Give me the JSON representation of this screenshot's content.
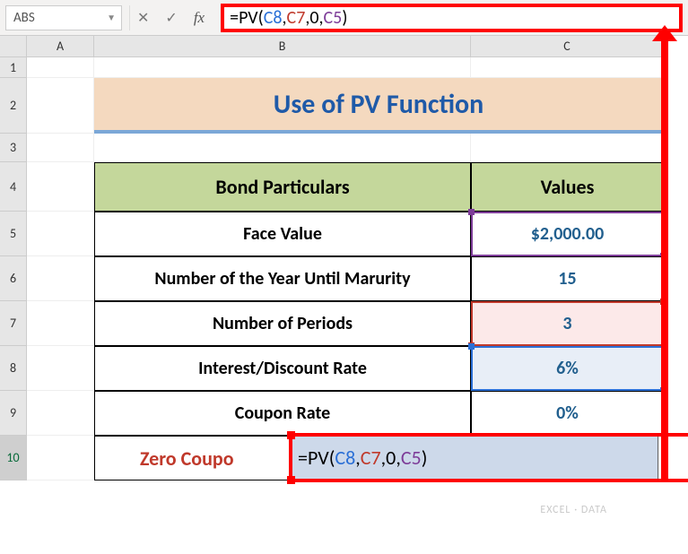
{
  "name_box": "ABS",
  "formula": {
    "prefix": "=",
    "fn": "PV",
    "open": "(",
    "arg1": "C8",
    "sep": ",",
    "arg2": "C7",
    "arg3": "0",
    "arg4": "C5",
    "close": ")"
  },
  "columns": {
    "A": "A",
    "B": "B",
    "C": "C"
  },
  "rows": {
    "r1": "1",
    "r2": "2",
    "r3": "3",
    "r4": "4",
    "r5": "5",
    "r6": "6",
    "r7": "7",
    "r8": "8",
    "r9": "9",
    "r10": "10"
  },
  "title": "Use of PV Function",
  "headers": {
    "particulars": "Bond Particulars",
    "values": "Values"
  },
  "table": {
    "face_value": {
      "label": "Face Value",
      "value": "$2,000.00"
    },
    "years": {
      "label": "Number of the Year Until Marurity",
      "value": "15"
    },
    "periods": {
      "label": "Number of Periods",
      "value": "3"
    },
    "rate": {
      "label": "Interest/Discount Rate",
      "value": "6%"
    },
    "coupon": {
      "label": "Coupon Rate",
      "value": "0%"
    }
  },
  "edit_row": {
    "label_visible": "Zero Coupo",
    "formula_prefix": "=PV(",
    "a1": "C8",
    "s1": ",",
    "a2": "C7",
    "s2": ",",
    "a3": "0",
    "s3": ",",
    "a4": "C5",
    "close": ")"
  },
  "watermark": "EXCEL · DATA"
}
